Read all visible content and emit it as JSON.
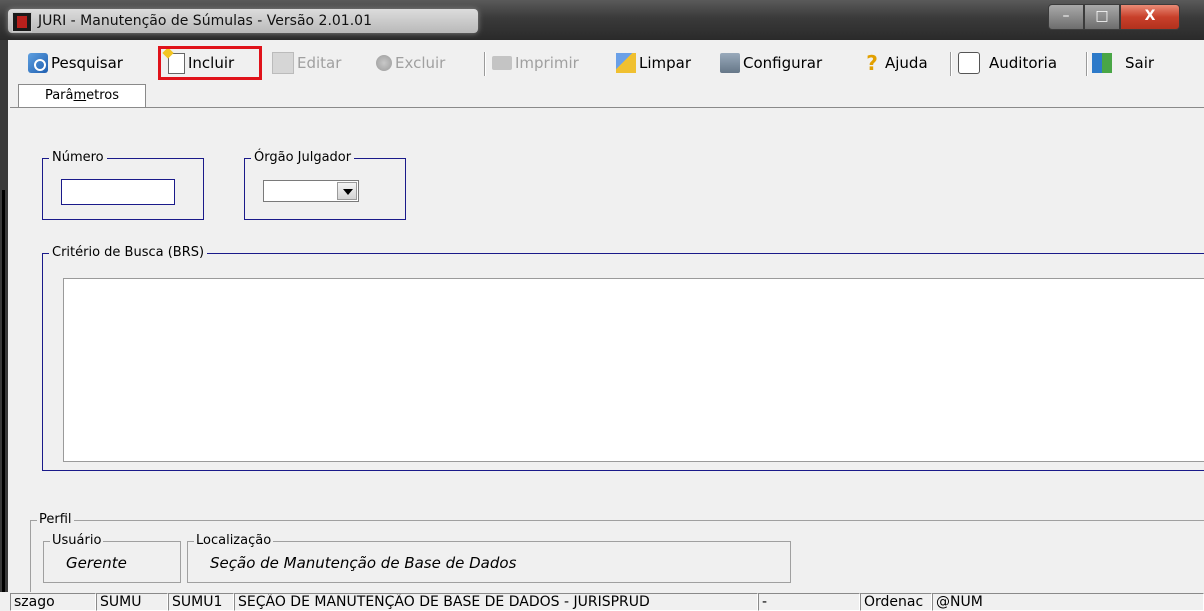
{
  "window": {
    "title": "JURI - Manutenção de Súmulas - Versão 2.01.01",
    "controls": {
      "minimize": "–",
      "maximize": "□",
      "close": "X"
    }
  },
  "toolbar": {
    "pesquisar": "Pesquisar",
    "incluir": "Incluir",
    "editar": "Editar",
    "excluir": "Excluir",
    "imprimir": "Imprimir",
    "limpar": "Limpar",
    "configurar": "Configurar",
    "ajuda": "Ajuda",
    "auditoria": "Auditoria",
    "sair": "Sair"
  },
  "tabs": {
    "parametros_prefix": "Parâ",
    "parametros_mnemonic": "m",
    "parametros_suffix": "etros"
  },
  "form": {
    "numero_label": "Número",
    "numero_value": "",
    "orgao_label": "Órgão Julgador",
    "orgao_value": "",
    "criterio_label": "Critério de Busca (BRS)",
    "criterio_value": ""
  },
  "perfil": {
    "label": "Perfil",
    "usuario_label": "Usuário",
    "usuario_value": "Gerente",
    "localizacao_label": "Localização",
    "localizacao_value": "Seção de Manutenção de Base de Dados"
  },
  "statusbar": {
    "panels": [
      "szago",
      "SUMU",
      "SUMU1",
      "SEÇÃO DE MANUTENÇÃO DE BASE DE DADOS - JURISPRUD",
      "-",
      "",
      "Ordenac",
      "@NUM"
    ]
  },
  "colors": {
    "highlight": "#e0121a",
    "groupbox_border": "#1a1a8a"
  }
}
